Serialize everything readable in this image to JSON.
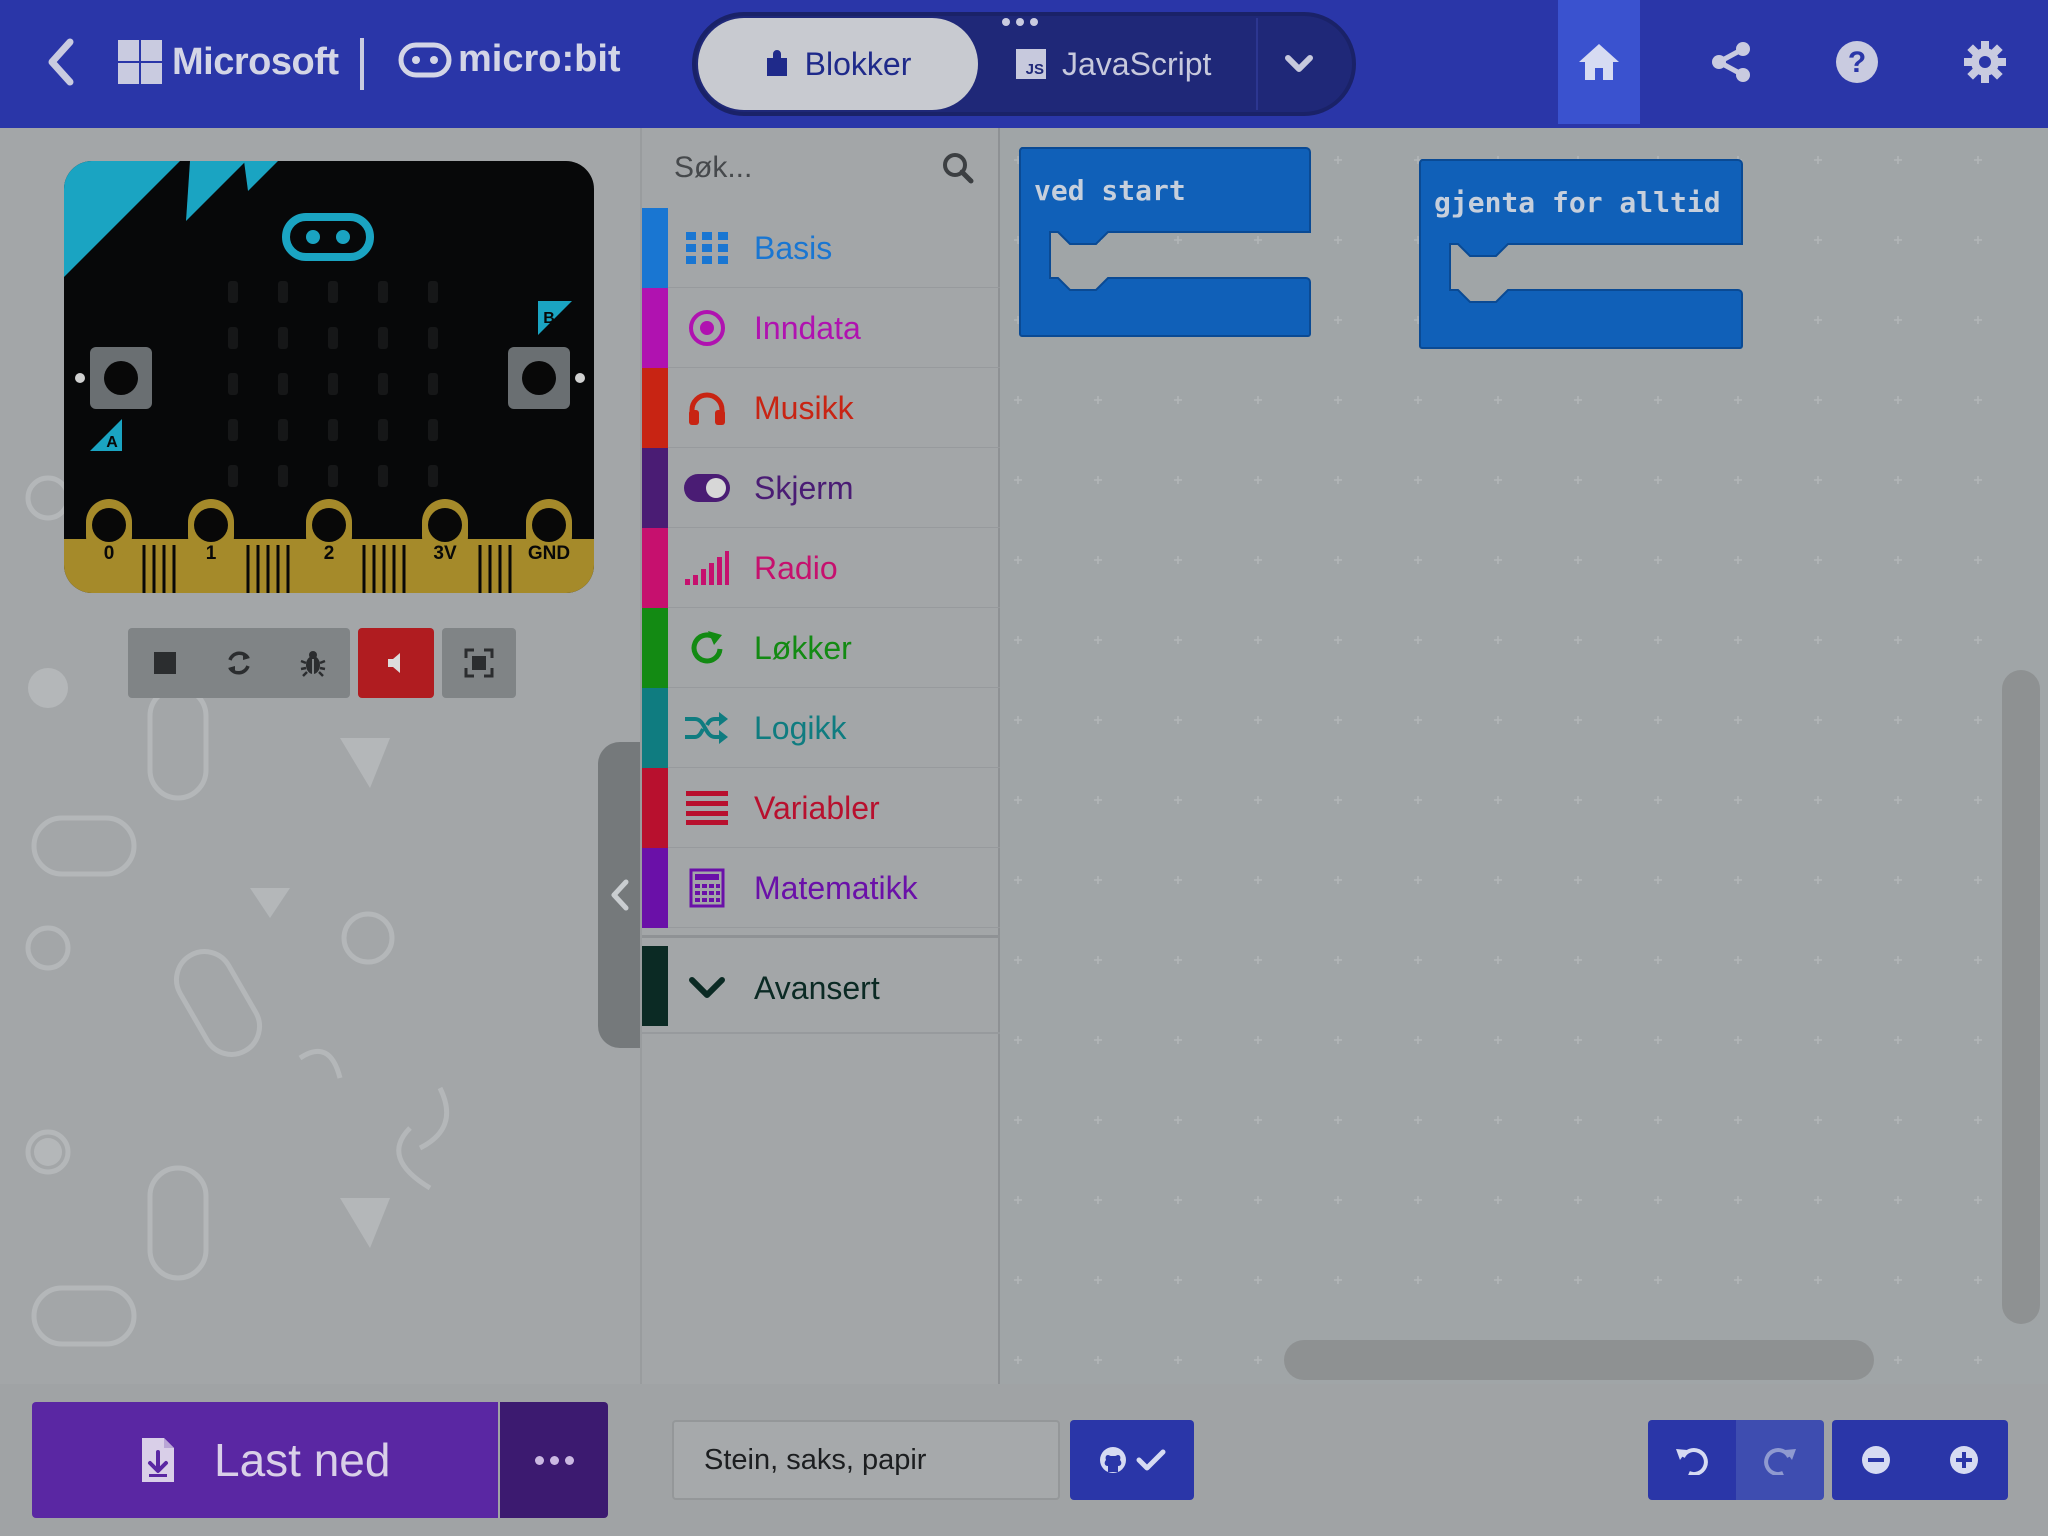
{
  "header": {
    "back_icon": "chevron-left-icon",
    "brand_microsoft": "Microsoft",
    "brand_microbit": "micro:bit",
    "tabs": [
      {
        "label": "Blokker",
        "icon": "puzzle-icon",
        "active": true
      },
      {
        "label": "JavaScript",
        "icon": "js-icon",
        "active": false
      }
    ],
    "js_badge": "JS",
    "actions": [
      "home-icon",
      "share-icon",
      "help-icon",
      "settings-icon"
    ]
  },
  "simulator": {
    "pins": [
      "0",
      "1",
      "2",
      "3V",
      "GND"
    ],
    "button_a": "A",
    "button_b": "B",
    "toolbar": [
      "stop-icon",
      "restart-icon",
      "debug-icon",
      "mute-icon",
      "fullscreen-icon"
    ]
  },
  "toolbox": {
    "search_placeholder": "Søk...",
    "categories": [
      {
        "label": "Basis",
        "color": "#1976d2",
        "icon": "grid-icon"
      },
      {
        "label": "Inndata",
        "color": "#b012b0",
        "icon": "target-icon"
      },
      {
        "label": "Musikk",
        "color": "#c82413",
        "icon": "headphones-icon"
      },
      {
        "label": "Skjerm",
        "color": "#4a1c74",
        "icon": "toggle-icon"
      },
      {
        "label": "Radio",
        "color": "#c6106e",
        "icon": "signal-bars-icon"
      },
      {
        "label": "Løkker",
        "color": "#138a13",
        "icon": "refresh-icon"
      },
      {
        "label": "Logikk",
        "color": "#0f7c80",
        "icon": "shuffle-icon"
      },
      {
        "label": "Variabler",
        "color": "#b8102e",
        "icon": "list-icon"
      },
      {
        "label": "Matematikk",
        "color": "#6a10a8",
        "icon": "calculator-icon"
      }
    ],
    "advanced": {
      "label": "Avansert",
      "color": "#0b2a24",
      "icon": "chevron-down-icon"
    }
  },
  "workspace": {
    "blocks": [
      {
        "label": "ved start"
      },
      {
        "label": "gjenta for alltid"
      }
    ]
  },
  "footer": {
    "download_label": "Last ned",
    "project_name": "Stein, saks, papir",
    "github_icon": "github-icon",
    "undo_icon": "undo-icon",
    "redo_icon": "redo-icon",
    "zoom_out_icon": "zoom-out-icon",
    "zoom_in_icon": "zoom-in-icon"
  }
}
